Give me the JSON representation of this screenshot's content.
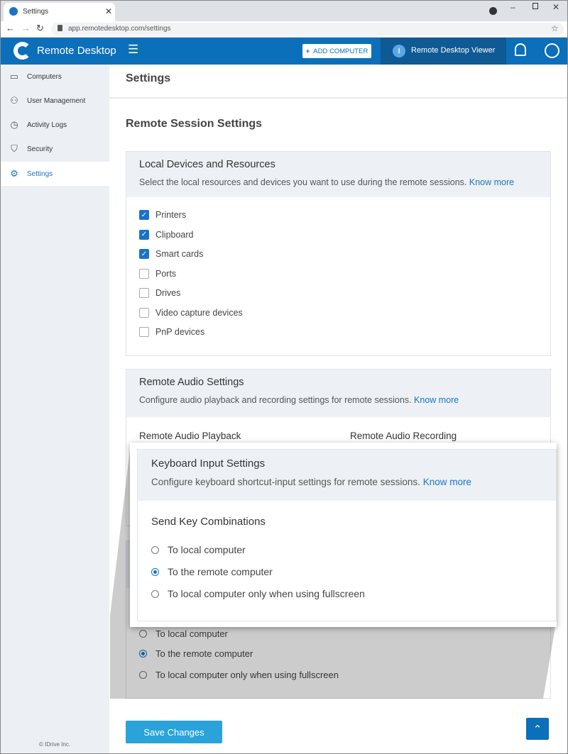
{
  "browser": {
    "tab_title": "Settings",
    "url": "app.remotedesktop.com/settings"
  },
  "header": {
    "app_name": "Remote Desktop",
    "add_computer": "ADD COMPUTER",
    "viewer": "Remote Desktop Viewer",
    "brand_color": "#0b6fba"
  },
  "sidebar": {
    "items": [
      {
        "label": "Computers",
        "icon": "monitor-icon"
      },
      {
        "label": "User Management",
        "icon": "user-gear-icon"
      },
      {
        "label": "Activity Logs",
        "icon": "history-icon"
      },
      {
        "label": "Security",
        "icon": "shield-icon"
      },
      {
        "label": "Settings",
        "icon": "gear-icon",
        "active": true
      }
    ],
    "footer": "© IDrive Inc."
  },
  "main": {
    "page_title": "Settings",
    "section_title": "Remote Session Settings",
    "local_devices": {
      "title": "Local Devices and Resources",
      "description": "Select the local resources and devices you want to use during the remote sessions.",
      "link": "Know more",
      "items": [
        {
          "label": "Printers",
          "checked": true
        },
        {
          "label": "Clipboard",
          "checked": true
        },
        {
          "label": "Smart cards",
          "checked": true
        },
        {
          "label": "Ports",
          "checked": false
        },
        {
          "label": "Drives",
          "checked": false
        },
        {
          "label": "Video capture devices",
          "checked": false
        },
        {
          "label": "PnP devices",
          "checked": false
        }
      ]
    },
    "audio": {
      "title": "Remote Audio Settings",
      "description": "Configure audio playback and recording settings for remote sessions.",
      "link": "Know more",
      "playback_label": "Remote Audio Playback",
      "recording_label": "Remote Audio Recording"
    },
    "keyboard": {
      "title": "Keyboard Input Settings",
      "description": "Configure keyboard shortcut-input settings for remote sessions.",
      "link": "Know more",
      "subtitle": "Send Key Combinations",
      "options": [
        {
          "label": "To local computer",
          "selected": false
        },
        {
          "label": "To the remote computer",
          "selected": true
        },
        {
          "label": "To local computer only when using fullscreen",
          "selected": false
        }
      ]
    },
    "save_label": "Save Changes"
  }
}
